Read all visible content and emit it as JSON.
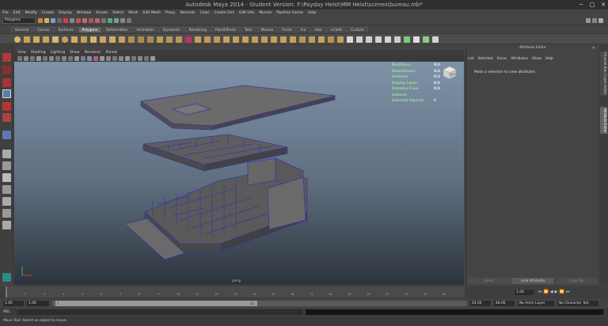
{
  "window": {
    "title": "Autodesk Maya 2014 - Student Version: F:\\Payday Heist\\MM Heist\\scenes\\bureau.mb*",
    "minimize_glyph": "─",
    "maximize_glyph": "□",
    "close_glyph": "✕"
  },
  "menubar": [
    "File",
    "Edit",
    "Modify",
    "Create",
    "Display",
    "Window",
    "Assets",
    "Select",
    "Mesh",
    "Edit Mesh",
    "Proxy",
    "Normals",
    "Color",
    "Create UVs",
    "Edit UVs",
    "Muscle",
    "Pipeline Cache",
    "Help"
  ],
  "status_line": {
    "mode": "Polygons"
  },
  "shelf_tabs": [
    "General",
    "Curves",
    "Surfaces",
    "Polygons",
    "Deformation",
    "Animation",
    "Dynamics",
    "Rendering",
    "PaintEffects",
    "Toon",
    "Muscle",
    "Fluids",
    "Fur",
    "Hair",
    "nCloth",
    "Custom"
  ],
  "active_shelf_tab": "Polygons",
  "panel_menu": [
    "View",
    "Shading",
    "Lighting",
    "Show",
    "Renderer",
    "Panels"
  ],
  "hud": [
    {
      "label": "Backfaces:",
      "value": "N/A"
    },
    {
      "label": "Smoothness:",
      "value": "N/A"
    },
    {
      "label": "Instance:",
      "value": "N/A"
    },
    {
      "label": "Display Layer:",
      "value": "N/A"
    },
    {
      "label": "Distance From Camera:",
      "value": "N/A"
    },
    {
      "label": "Selected Objects:",
      "value": "0"
    }
  ],
  "viewcube": {
    "face_label": "RIGHT"
  },
  "viewport": {
    "camera_label": "persp"
  },
  "attribute_editor": {
    "title": "Attribute Editor",
    "menu": [
      "List",
      "Selected",
      "Focus",
      "Attributes",
      "Show",
      "Help"
    ],
    "empty_message": "Make a selection to view attributes",
    "buttons": [
      "Select",
      "Load Attributes",
      "Copy Tab"
    ]
  },
  "side_tabs": [
    "Channel Box / Layer Editor",
    "Attribute Editor"
  ],
  "timeline": {
    "ticks": [
      "1",
      "2",
      "3",
      "4",
      "5",
      "6",
      "7",
      "8",
      "9",
      "10",
      "11",
      "12",
      "13",
      "14",
      "15",
      "16",
      "17",
      "18",
      "19",
      "20",
      "21",
      "22",
      "23",
      "24"
    ],
    "current_frame": "1.00"
  },
  "range": {
    "start_time": "1.00",
    "playback_start": "1.00",
    "range_start_label": "1",
    "range_end_label": "24",
    "playback_end": "24.00",
    "end_time": "48.00",
    "anim_layer": "No Anim Layer",
    "character_set": "No Character Set"
  },
  "command_line": {
    "label": "MEL"
  },
  "help_line": "Move Tool: Select an object to move."
}
